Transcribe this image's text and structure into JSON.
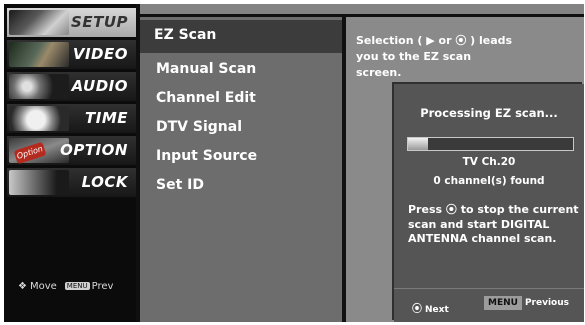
{
  "left_menu": {
    "items": [
      {
        "label": "SETUP",
        "selected": true
      },
      {
        "label": "VIDEO",
        "selected": false
      },
      {
        "label": "AUDIO",
        "selected": false
      },
      {
        "label": "TIME",
        "selected": false
      },
      {
        "label": "OPTION",
        "selected": false
      },
      {
        "label": "LOCK",
        "selected": false
      }
    ],
    "option_tag": "Option",
    "hint": {
      "move_label": "Move",
      "menu_key": "MENU",
      "prev_label": "Prev"
    }
  },
  "submenu": {
    "items": [
      "EZ Scan",
      "Manual Scan",
      "Channel Edit",
      "DTV Signal",
      "Input Source",
      "Set ID"
    ],
    "selected": "EZ Scan"
  },
  "info_text": "Selection ( ▶ or ⦿ ) leads you to the EZ scan screen.",
  "popup": {
    "title": "Processing EZ scan...",
    "progress": 0.12,
    "channel": "TV Ch.20",
    "found": "0 channel(s) found",
    "message": "Press ⦿ to stop the current scan and start DIGITAL ANTENNA channel scan.",
    "next_label": "Next",
    "menu_key": "MENU",
    "previous_label": "Previous"
  },
  "colors": {
    "panel_dark": "#0b0b0b",
    "submenu_bg": "#6d6d6d",
    "info_bg": "#8a8a8a",
    "popup_bg": "#555555",
    "selected_row": "#3c3c3c"
  }
}
